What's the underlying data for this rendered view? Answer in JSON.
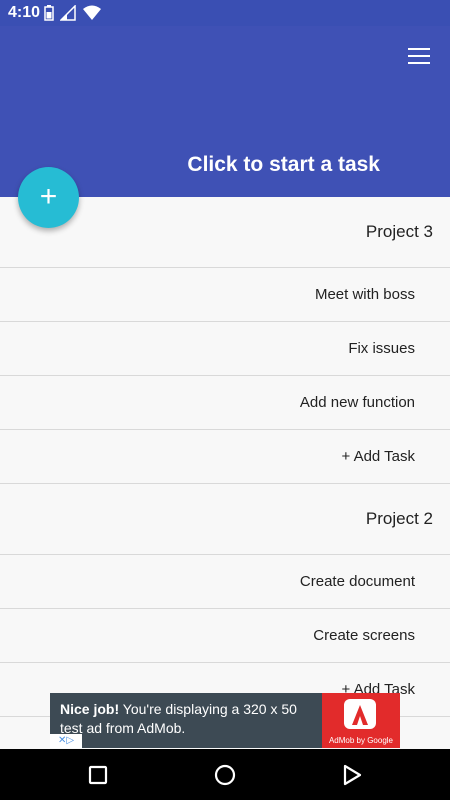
{
  "status_bar": {
    "time": "4:10"
  },
  "app_bar": {
    "title": "Click to start a task"
  },
  "fab": {
    "label": "+"
  },
  "projects": [
    {
      "name": "Project 3",
      "tasks": [
        "Meet with boss",
        "Fix issues",
        "Add new function"
      ],
      "add_task_label": "+ Add Task"
    },
    {
      "name": "Project 2",
      "tasks": [
        "Create document",
        "Create screens"
      ],
      "add_task_label": "+ Add Task"
    }
  ],
  "ad": {
    "headline": "Nice job!",
    "text": "You're displaying a 320 x 50 test ad from AdMob.",
    "brand": "AdMob by Google"
  },
  "colors": {
    "primary": "#3f51b5",
    "status": "#3a4fb3",
    "accent": "#26bcd4",
    "ad_bg": "#3d4a54",
    "ad_brand": "#e22b2b"
  }
}
